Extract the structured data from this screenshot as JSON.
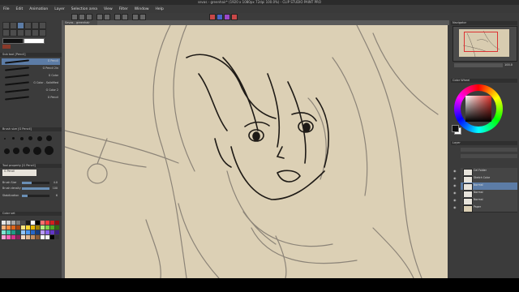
{
  "window_title": "sevas - greenhair* (1920 x 1080px 72dpi 100.0%) - CLIP STUDIO PAINT PRO",
  "menu": [
    "File",
    "Edit",
    "Animation",
    "Layer",
    "Selection area",
    "View",
    "Filter",
    "Window",
    "Help"
  ],
  "doc_tab": "Sevas - greenhair",
  "brush_panel": {
    "header": "Sub tool [Pencil]",
    "brushes": [
      "G Pencil",
      "G Pencil 2in",
      "G Color",
      "G Color - Solidified",
      "G Color 2",
      "G Pencil"
    ]
  },
  "brush_size_panel": {
    "header": "Brush size [G Pencil]"
  },
  "tool_property": {
    "header": "Tool property [G Pencil]",
    "tool_name": "G Pencil",
    "rows": [
      {
        "label": "Brush Size",
        "value": "4.0",
        "fill": 0.35
      },
      {
        "label": "Brush density",
        "value": "100",
        "fill": 1.0
      },
      {
        "label": "Stabilization",
        "value": "6",
        "fill": 0.2
      }
    ]
  },
  "color_set_header": "Color set",
  "palette_colors": [
    "#e6e6e6",
    "#cfcfcf",
    "#a8a8a8",
    "#7a7a7a",
    "#4d4d4d",
    "#1a1a1a",
    "#ffffff",
    "#000000",
    "#ff6f6f",
    "#ff3b3b",
    "#d21e1e",
    "#8f1010",
    "#ffb37a",
    "#ff8a3d",
    "#e0661a",
    "#a6430d",
    "#ffe680",
    "#ffd633",
    "#e6b800",
    "#a38200",
    "#b8ef80",
    "#7fd24a",
    "#4ea822",
    "#2e6b12",
    "#7fe6d2",
    "#3fc8b0",
    "#1f9a86",
    "#0f5e52",
    "#8fc4ff",
    "#4d98f0",
    "#2666c8",
    "#163d80",
    "#b89cff",
    "#8a63f0",
    "#6236c8",
    "#3a1e80",
    "#ffa3d6",
    "#ff66b8",
    "#d9338f",
    "#8f1f5c",
    "#f2d9c2",
    "#e0b894",
    "#c48f63",
    "#8a5a36",
    "#ffffff",
    "#f0f0f0",
    "#000000",
    "#333333"
  ],
  "right_panel": {
    "navigator_header": "Navigator",
    "zoom": "100.0",
    "color_wheel_header": "Color Wheel",
    "main_color": "#111111",
    "sub_color": "#ffffff",
    "layers_header": "Layer",
    "layers": [
      {
        "name": "Cel Folder",
        "thumb": "#e8e4dc",
        "selected": false
      },
      {
        "name": "Sketch Color",
        "thumb": "#e8e4dc",
        "selected": false
      },
      {
        "name": "Normal",
        "thumb": "#e8e4dc",
        "selected": true
      },
      {
        "name": "Normal",
        "thumb": "#e8e4dc",
        "selected": false
      },
      {
        "name": "Normal",
        "thumb": "#e8e4dc",
        "selected": false
      },
      {
        "name": "Paper",
        "thumb": "#dcd0b5",
        "selected": false
      }
    ]
  },
  "colors": {
    "canvas_paper": "#dcd0b5",
    "panel_bg": "#3b3b3b",
    "accent": "#5c7ca6"
  }
}
